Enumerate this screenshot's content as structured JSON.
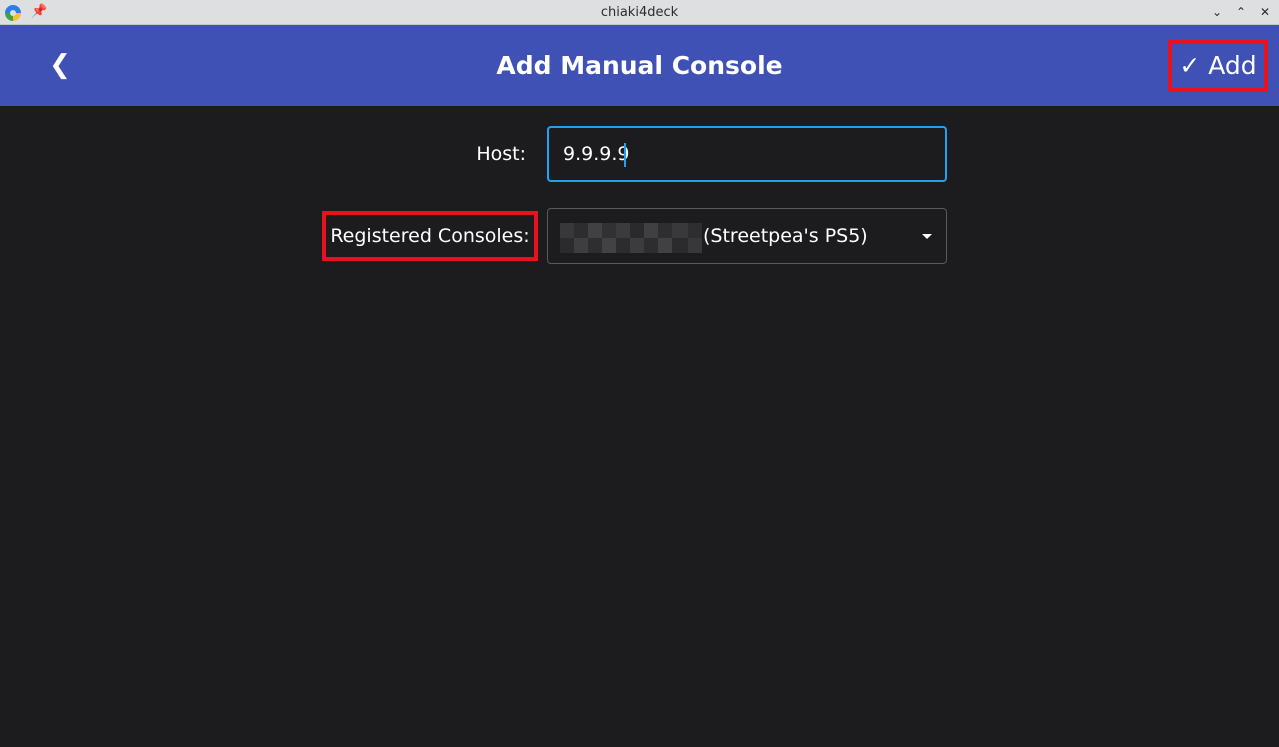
{
  "window": {
    "title": "chiaki4deck",
    "controls": {
      "minimize_glyph": "⌄",
      "maximize_glyph": "⌃",
      "close_glyph": "✕"
    },
    "icons": [
      "app-icon",
      "pin-icon"
    ]
  },
  "header": {
    "back_glyph": "❮",
    "title": "Add Manual Console",
    "add_label": "✓ Add",
    "background_color": "#3f51b5"
  },
  "form": {
    "host": {
      "label": "Host:",
      "value": "9.9.9.9",
      "focus_color": "#1fa2f0"
    },
    "registered_consoles": {
      "label": "Registered Consoles:",
      "selected_value": "(Streetpea's PS5)",
      "selected_prefix_redacted": true
    }
  },
  "highlight_color": "#e8121c"
}
